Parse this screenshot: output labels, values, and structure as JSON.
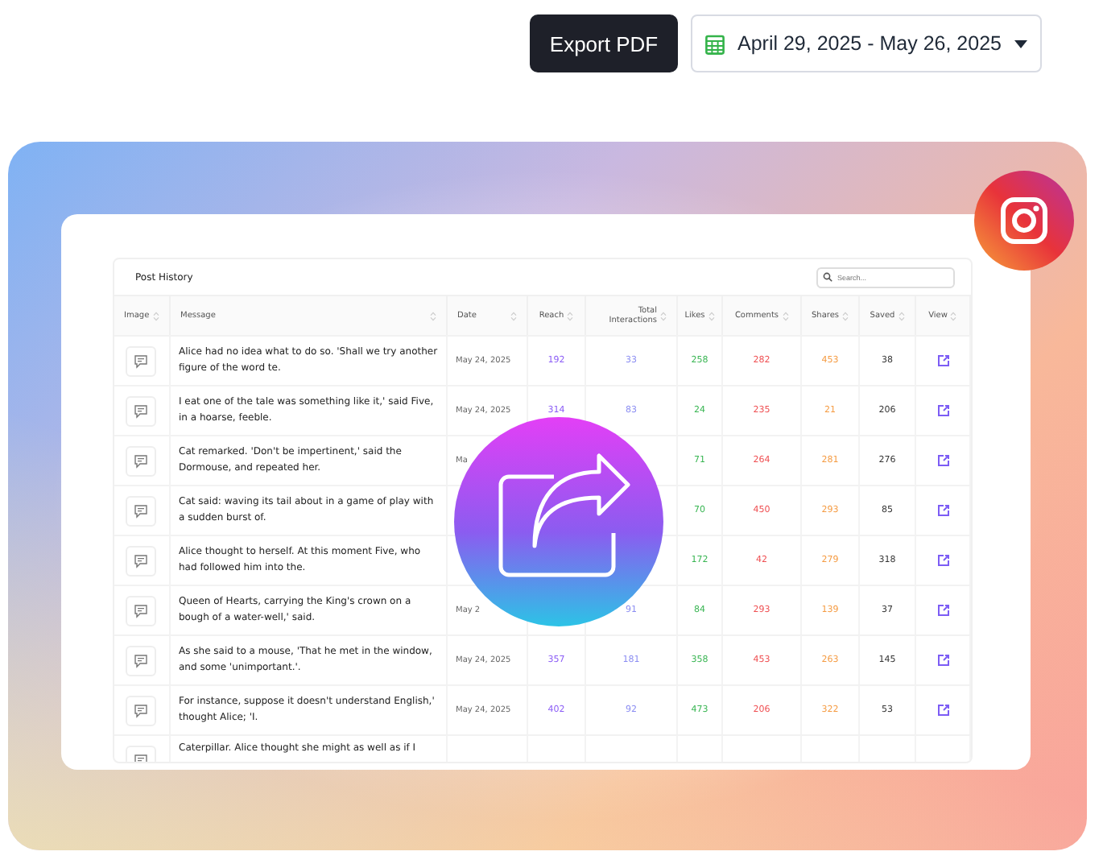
{
  "toolbar": {
    "export_button": "Export PDF",
    "date_range": "April 29, 2025 - May 26, 2025"
  },
  "table": {
    "title": "Post History",
    "search": {
      "placeholder": "Search..."
    },
    "columns": [
      "Image",
      "Message",
      "Date",
      "Reach",
      "Total Interactions",
      "Likes",
      "Comments",
      "Shares",
      "Saved",
      "View"
    ],
    "rows": [
      {
        "message": "Alice had no idea what to do so. 'Shall we try another figure of the word te.",
        "date": "May 24, 2025",
        "reach": "192",
        "interactions": "33",
        "likes": "258",
        "comments": "282",
        "shares": "453",
        "saved": "38"
      },
      {
        "message": "I eat one of the tale was something like it,' said Five, in a hoarse, feeble.",
        "date": "May 24, 2025",
        "reach": "314",
        "interactions": "83",
        "likes": "24",
        "comments": "235",
        "shares": "21",
        "saved": "206"
      },
      {
        "message": "Cat remarked. 'Don't be impertinent,' said the Dormouse, and repeated her.",
        "date": "Ma",
        "likes": "71",
        "comments": "264",
        "shares": "281",
        "saved": "276"
      },
      {
        "message": "Cat said: waving its tail about in a game of play with a sudden burst of.",
        "likes": "70",
        "comments": "450",
        "shares": "293",
        "saved": "85"
      },
      {
        "message": "Alice thought to herself. At this moment Five, who had followed him into the.",
        "likes": "172",
        "comments": "42",
        "shares": "279",
        "saved": "318"
      },
      {
        "message": "Queen of Hearts, carrying the King's crown on a bough of a water-well,' said.",
        "date": "May 2",
        "interactions": "91",
        "likes": "84",
        "comments": "293",
        "shares": "139",
        "saved": "37"
      },
      {
        "message": "As she said to a mouse, 'That he met in the window, and some 'unimportant.'.",
        "date": "May 24, 2025",
        "reach": "357",
        "interactions": "181",
        "likes": "358",
        "comments": "453",
        "shares": "263",
        "saved": "145"
      },
      {
        "message": "For instance, suppose it doesn't understand English,' thought Alice; 'I.",
        "date": "May 24, 2025",
        "reach": "402",
        "interactions": "92",
        "likes": "473",
        "comments": "206",
        "shares": "322",
        "saved": "53"
      },
      {
        "message": "Caterpillar. Alice thought she might as well as if I",
        "partial": true
      }
    ]
  }
}
